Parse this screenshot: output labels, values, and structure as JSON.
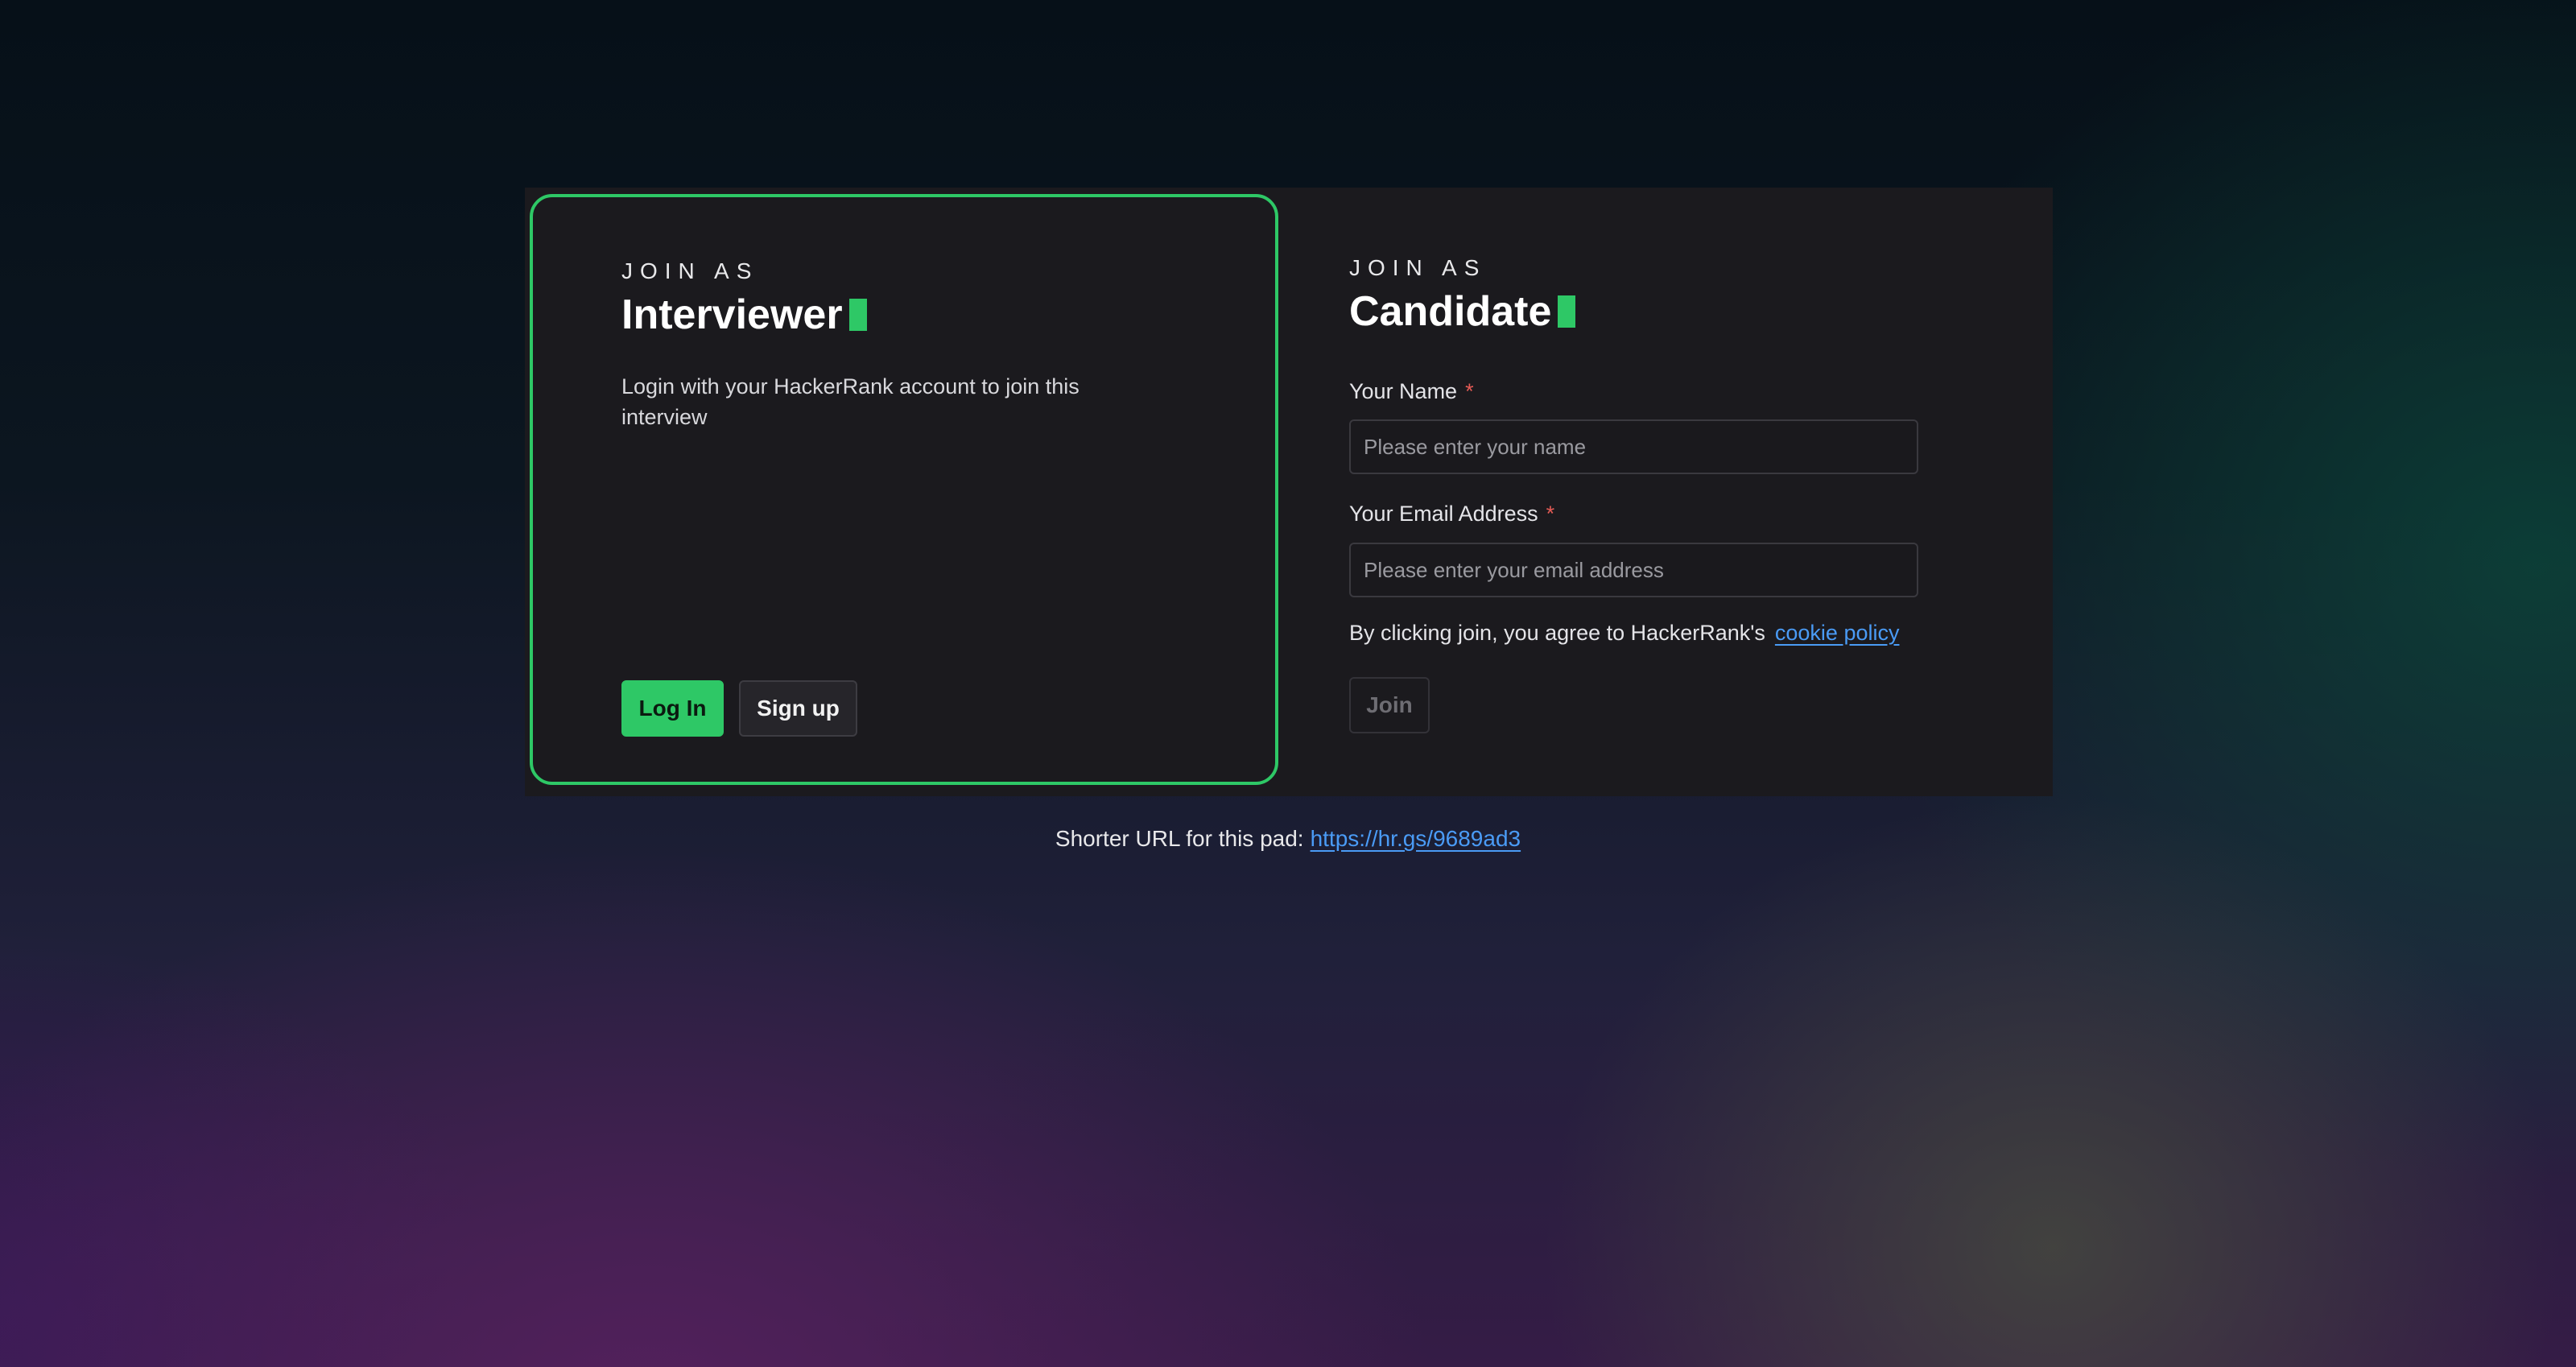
{
  "interviewer": {
    "eyebrow": "JOIN AS",
    "title": "Interviewer",
    "description": "Login with your HackerRank account to join this interview",
    "login_label": "Log In",
    "signup_label": "Sign up"
  },
  "candidate": {
    "eyebrow": "JOIN AS",
    "title": "Candidate",
    "name_label": "Your Name",
    "name_placeholder": "Please enter your name",
    "name_value": "",
    "email_label": "Your Email Address",
    "email_placeholder": "Please enter your email address",
    "email_value": "",
    "required_marker": "*",
    "agree_text": "By clicking join, you agree to HackerRank's",
    "cookie_link": "cookie policy",
    "join_label": "Join"
  },
  "footer": {
    "short_url_text": "Shorter URL for this pad:",
    "short_url_link": "https://hr.gs/9689ad3"
  },
  "colors": {
    "accent": "#2ec866",
    "link": "#4a9bf5",
    "required": "#e55b55",
    "panel": "#1b1a1e"
  },
  "icons": {
    "title_cursor": "terminal-block-cursor"
  }
}
